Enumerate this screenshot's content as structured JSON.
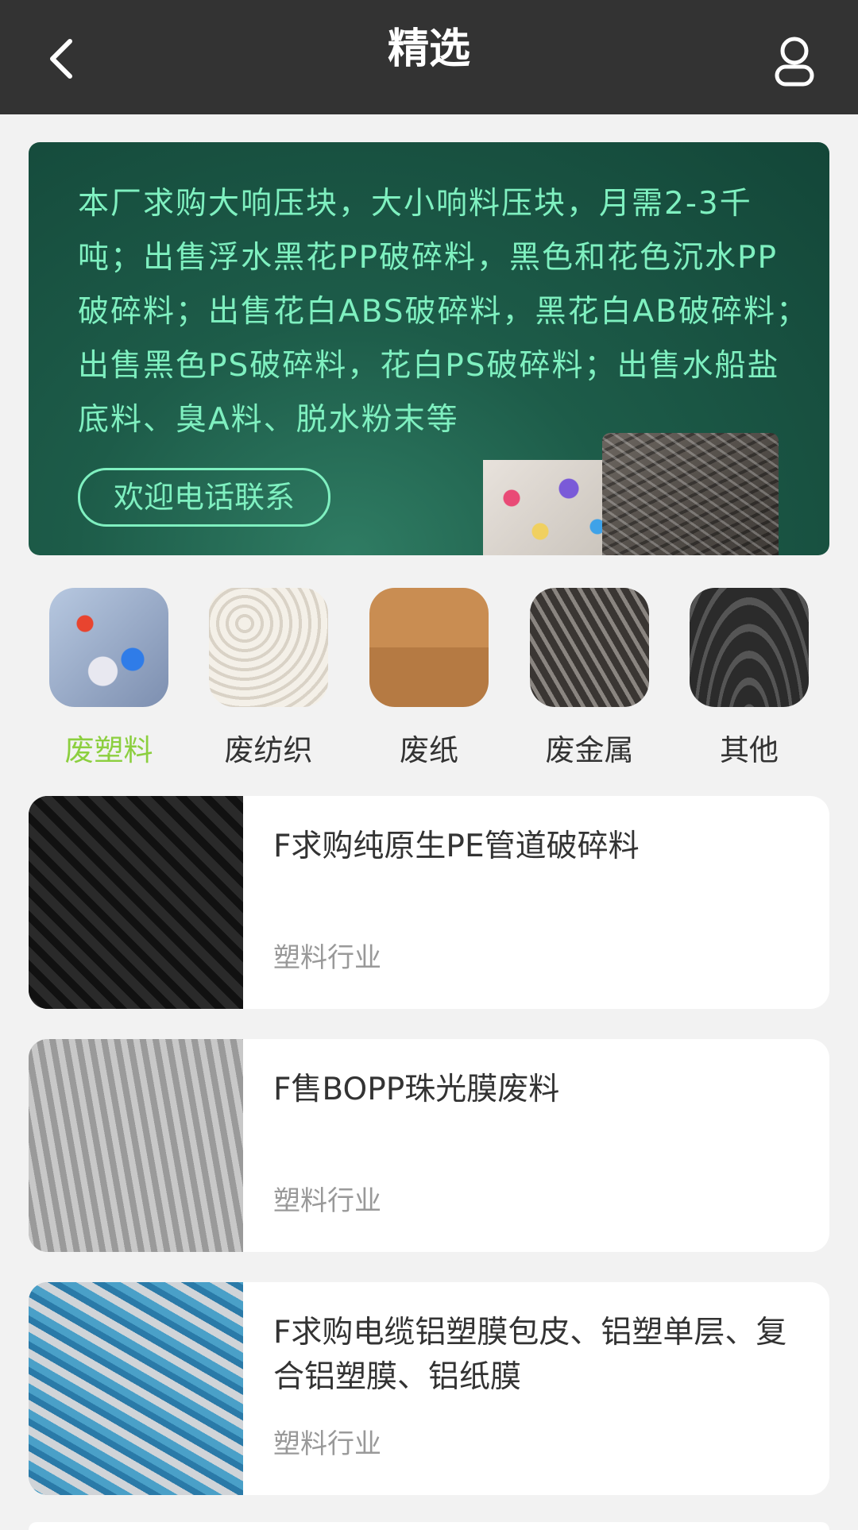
{
  "header": {
    "title": "精选",
    "back_icon": "chevron-left-icon",
    "user_icon": "user-icon"
  },
  "banner": {
    "text": "本厂求购大响压块，大小响料压块，月需2-3千吨；出售浮水黑花PP破碎料，黑色和花色沉水PP破碎料；出售花白ABS破碎料，黑花白AB破碎料；出售黑色PS破碎料，花白PS破碎料；出售水船盐底料、臭A料、脱水粉末等",
    "button_label": "欢迎电话联系",
    "text_color": "#7ff0c0"
  },
  "categories": [
    {
      "label": "废塑料",
      "active": true
    },
    {
      "label": "废纺织",
      "active": false
    },
    {
      "label": "废纸",
      "active": false
    },
    {
      "label": "废金属",
      "active": false
    },
    {
      "label": "其他",
      "active": false
    }
  ],
  "colors": {
    "accent": "#8ccf3f",
    "header_bg": "#333333"
  },
  "listings": [
    {
      "title": "F求购纯原生PE管道破碎料",
      "tag": "塑料行业"
    },
    {
      "title": "F售BOPP珠光膜废料",
      "tag": "塑料行业"
    },
    {
      "title": "F求购电缆铝塑膜包皮、铝塑单层、复合铝塑膜、铝纸膜",
      "tag": "塑料行业"
    }
  ]
}
